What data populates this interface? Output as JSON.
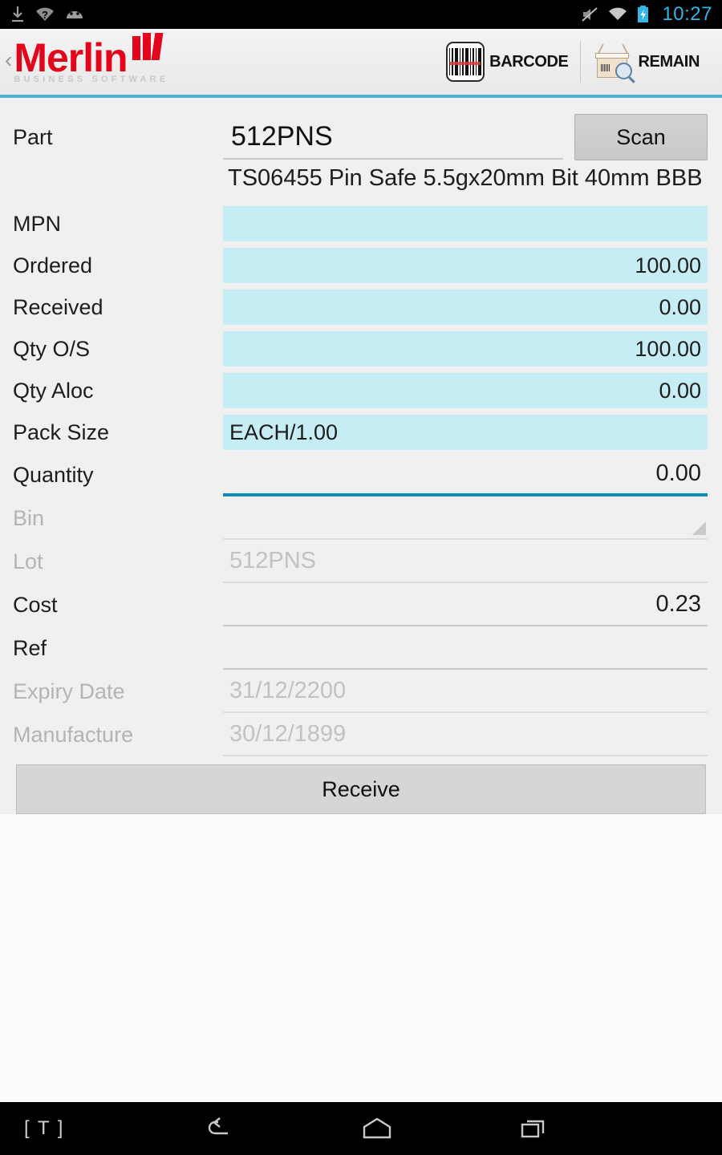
{
  "statusbar": {
    "left_icons": [
      "download-icon",
      "wifi-unknown-icon",
      "android-head-icon"
    ],
    "right_icons": [
      "mute-icon",
      "wifi-icon",
      "battery-charging-icon"
    ],
    "clock": "10:27"
  },
  "appbar": {
    "back_label": "‹",
    "brand_name": "Merlin",
    "brand_tagline": "BUSINESS SOFTWARE",
    "actions": [
      {
        "icon": "barcode-icon",
        "label": "BARCODE"
      },
      {
        "icon": "box-search-icon",
        "label": "REMAIN"
      }
    ]
  },
  "form": {
    "part": {
      "label": "Part",
      "value": "512PNS",
      "scan_label": "Scan",
      "description": "TS06455 Pin Safe 5.5gx20mm Bit 40mm BBB"
    },
    "readonly_fields": [
      {
        "label": "MPN",
        "value": "",
        "align": "left"
      },
      {
        "label": "Ordered",
        "value": "100.00",
        "align": "right"
      },
      {
        "label": "Received",
        "value": "0.00",
        "align": "right"
      },
      {
        "label": "Qty O/S",
        "value": "100.00",
        "align": "right"
      },
      {
        "label": "Qty Aloc",
        "value": "0.00",
        "align": "right"
      },
      {
        "label": "Pack Size",
        "value": "EACH/1.00",
        "align": "left"
      }
    ],
    "quantity": {
      "label": "Quantity",
      "value": "0.00"
    },
    "bin": {
      "label": "Bin",
      "value": ""
    },
    "lot": {
      "label": "Lot",
      "placeholder": "512PNS"
    },
    "cost": {
      "label": "Cost",
      "value": "0.23"
    },
    "ref": {
      "label": "Ref",
      "value": ""
    },
    "expiry": {
      "label": "Expiry Date",
      "placeholder": "31/12/2200"
    },
    "manufacture": {
      "label": "Manufacture",
      "placeholder": "30/12/1899"
    },
    "submit_label": "Receive"
  },
  "navbar": {
    "ime_label": "[ T ]",
    "buttons": [
      "back-icon",
      "home-icon",
      "recents-icon"
    ]
  },
  "colors": {
    "brand_red": "#e3051b",
    "accent_blue": "#4fb3d4",
    "focus_teal": "#0d8db4",
    "readonly_cyan": "#c5edf3",
    "status_clock_blue": "#33b5e5"
  }
}
